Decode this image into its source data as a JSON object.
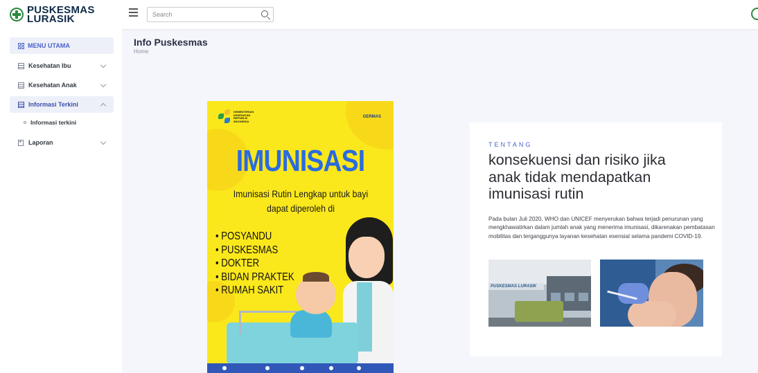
{
  "app": {
    "brand_line1": "PUSKESMAS",
    "brand_line2": "LURASIK"
  },
  "search": {
    "placeholder": "Search",
    "value": ""
  },
  "sidebar": {
    "header": "MENU UTAMA",
    "items": [
      {
        "label": "Kesehatan Ibu",
        "expanded": false
      },
      {
        "label": "Kesehatan Anak",
        "expanded": false
      },
      {
        "label": "Informasi Terkini",
        "expanded": true
      },
      {
        "label": "Laporan",
        "expanded": false
      }
    ],
    "subitems": [
      {
        "label": "Informasi terkini"
      }
    ]
  },
  "page": {
    "title": "Info Puskesmas",
    "breadcrumb": "Home"
  },
  "poster": {
    "org_text": "KEMENTERIAN KESEHATAN REPUBLIK INDONESIA",
    "germas": "GERMAS",
    "title": "IMUNISASI",
    "subtitle": "Imunisasi Rutin Lengkap untuk bayi dapat diperoleh di",
    "places": [
      "POSYANDU",
      "PUSKESMAS",
      "DOKTER",
      "BIDAN PRAKTEK",
      "RUMAH SAKIT"
    ]
  },
  "article": {
    "kicker": "TENTANG",
    "title": "konsekuensi dan risiko jika anak tidak mendapatkan imunisasi rutin",
    "body": "Pada bulan Juli 2020, WHO dan UNICEF menyerukan bahwa terjadi penurunan yang mengkhawatirkan dalam jumlah anak yang menerima imunisasi, dikarenakan pembatasan mobilitas dan terganggunya layanan kesehatan esensial selama pandemi COVID-19.",
    "building_sign": "PUSKESMAS LURASIK"
  },
  "colors": {
    "brand_green": "#2b8a3e",
    "accent_blue": "#4a62c9",
    "poster_yellow": "#fbe81c"
  }
}
